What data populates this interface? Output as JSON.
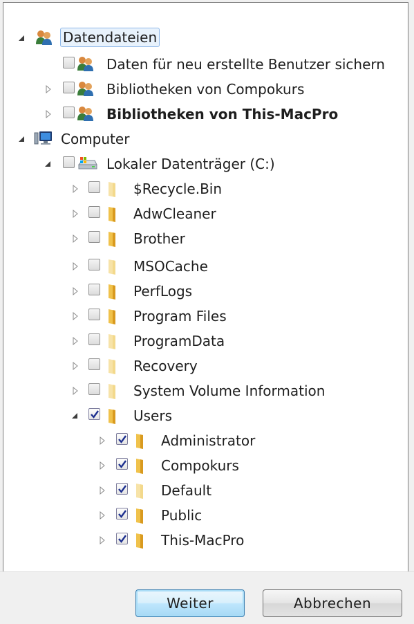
{
  "tree": {
    "nodes": [
      {
        "label": "Datendateien",
        "icon": "users-icon",
        "expander": "expanded",
        "checkbox": null,
        "bold": false,
        "selected": true
      },
      {
        "label": "Daten für neu erstellte Benutzer sichern",
        "icon": "users-icon",
        "expander": "none",
        "checkbox": false,
        "bold": false,
        "selected": false
      },
      {
        "label": "Bibliotheken von Compokurs",
        "icon": "users-icon",
        "expander": "collapsed",
        "checkbox": false,
        "bold": false,
        "selected": false
      },
      {
        "label": "Bibliotheken von This-MacPro",
        "icon": "users-icon",
        "expander": "collapsed",
        "checkbox": false,
        "bold": true,
        "selected": false
      },
      {
        "label": "Computer",
        "icon": "computer-icon",
        "expander": "expanded",
        "checkbox": null,
        "bold": false,
        "selected": false
      },
      {
        "label": "Lokaler Datenträger (C:)",
        "icon": "drive-icon",
        "expander": "expanded",
        "checkbox": false,
        "bold": false,
        "selected": false
      },
      {
        "label": "$Recycle.Bin",
        "icon": "folder-faded-icon",
        "expander": "collapsed",
        "checkbox": false,
        "bold": false,
        "selected": false
      },
      {
        "label": "AdwCleaner",
        "icon": "folder-icon",
        "expander": "collapsed",
        "checkbox": false,
        "bold": false,
        "selected": false
      },
      {
        "label": "Brother",
        "icon": "folder-icon",
        "expander": "collapsed",
        "checkbox": false,
        "bold": false,
        "selected": false
      },
      {
        "label": "MSOCache",
        "icon": "folder-faded-icon",
        "expander": "collapsed",
        "checkbox": false,
        "bold": false,
        "selected": false
      },
      {
        "label": "PerfLogs",
        "icon": "folder-icon",
        "expander": "collapsed",
        "checkbox": false,
        "bold": false,
        "selected": false
      },
      {
        "label": "Program Files",
        "icon": "folder-icon",
        "expander": "collapsed",
        "checkbox": false,
        "bold": false,
        "selected": false
      },
      {
        "label": "ProgramData",
        "icon": "folder-faded-icon",
        "expander": "collapsed",
        "checkbox": false,
        "bold": false,
        "selected": false
      },
      {
        "label": "Recovery",
        "icon": "folder-faded-icon",
        "expander": "collapsed",
        "checkbox": false,
        "bold": false,
        "selected": false
      },
      {
        "label": "System Volume Information",
        "icon": "folder-faded-icon",
        "expander": "collapsed",
        "checkbox": false,
        "bold": false,
        "selected": false
      },
      {
        "label": "Users",
        "icon": "folder-icon",
        "expander": "expanded",
        "checkbox": true,
        "bold": false,
        "selected": false
      },
      {
        "label": "Administrator",
        "icon": "folder-icon",
        "expander": "collapsed",
        "checkbox": true,
        "bold": false,
        "selected": false
      },
      {
        "label": "Compokurs",
        "icon": "folder-icon",
        "expander": "collapsed",
        "checkbox": true,
        "bold": false,
        "selected": false
      },
      {
        "label": "Default",
        "icon": "folder-faded-icon",
        "expander": "collapsed",
        "checkbox": true,
        "bold": false,
        "selected": false
      },
      {
        "label": "Public",
        "icon": "folder-icon",
        "expander": "collapsed",
        "checkbox": true,
        "bold": false,
        "selected": false
      },
      {
        "label": "This-MacPro",
        "icon": "folder-icon",
        "expander": "collapsed",
        "checkbox": true,
        "bold": false,
        "selected": false
      }
    ]
  },
  "buttons": {
    "next_label": "Weiter",
    "cancel_label": "Abbrechen"
  },
  "colors": {
    "selection_bg": "#e8f2fc",
    "selection_border": "#8fb8e8",
    "checkmark": "#1c2f8f",
    "folder": "#e9b84a"
  }
}
